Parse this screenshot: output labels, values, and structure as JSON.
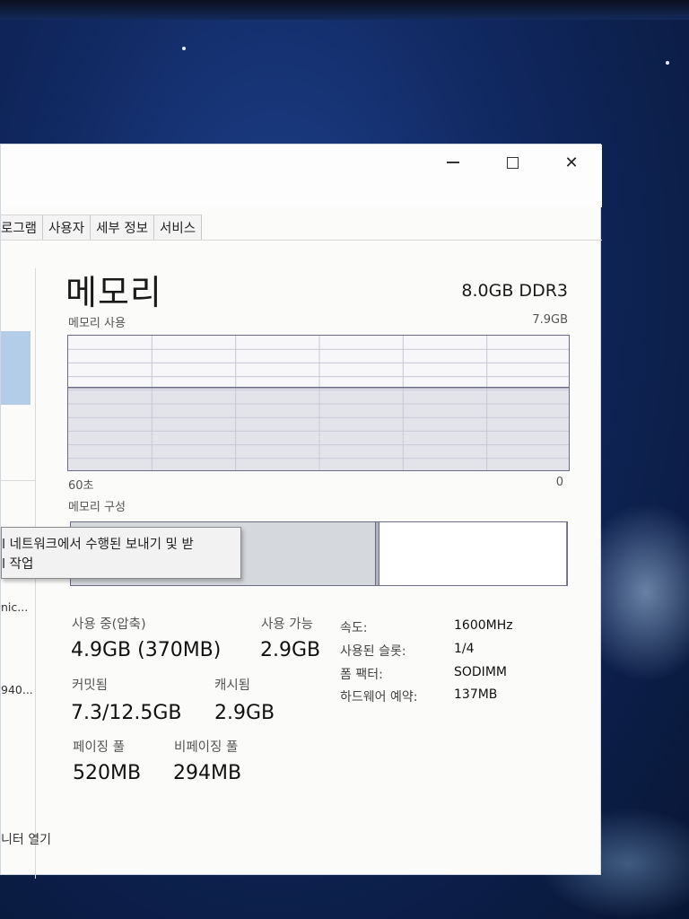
{
  "window": {
    "tabs": [
      "로그램",
      "사용자",
      "세부 정보",
      "서비스"
    ]
  },
  "sidebar": {
    "items": [
      {
        "label": "nic..."
      },
      {
        "label": "940..."
      }
    ]
  },
  "memory": {
    "title": "메모리",
    "spec": "8.0GB DDR3",
    "usage_label": "메모리 사용",
    "usage_max": "7.9GB",
    "axis_left": "60초",
    "axis_right": "0",
    "composition_label": "메모리 구성",
    "usage_fraction": 0.62
  },
  "tooltip": {
    "line1": "l 네트워크에서 수행된 보내기 및 받",
    "line2": "l 작업"
  },
  "stats": {
    "in_use_label": "사용 중(압축)",
    "in_use_value": "4.9GB (370MB)",
    "available_label": "사용 가능",
    "available_value": "2.9GB",
    "committed_label": "커밋됨",
    "committed_value": "7.3/12.5GB",
    "cached_label": "캐시됨",
    "cached_value": "2.9GB",
    "paged_label": "페이징 풀",
    "paged_value": "520MB",
    "nonpaged_label": "비페이징 풀",
    "nonpaged_value": "294MB"
  },
  "specs": [
    {
      "label": "속도:",
      "value": "1600MHz"
    },
    {
      "label": "사용된 슬롯:",
      "value": "1/4"
    },
    {
      "label": "폼 팩터:",
      "value": "SODIMM"
    },
    {
      "label": "하드웨어 예약:",
      "value": "137MB"
    }
  ],
  "footer": {
    "link": "니터 열기"
  },
  "colors": {
    "graph_border": "#6b6b8a",
    "selection": "#b3cde9"
  }
}
